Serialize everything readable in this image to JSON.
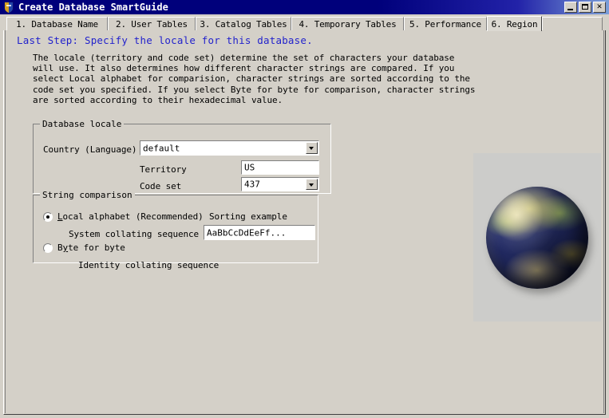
{
  "window": {
    "title": "Create Database SmartGuide",
    "icon": "app-icon",
    "buttons": {
      "minimize": "minimize",
      "maximize": "maximize",
      "close": "close"
    }
  },
  "tabs": [
    {
      "label": "1. Database Name",
      "active": false
    },
    {
      "label": "2. User Tables",
      "active": false
    },
    {
      "label": "3. Catalog Tables",
      "active": false
    },
    {
      "label": "4. Temporary Tables",
      "active": false
    },
    {
      "label": "5. Performance",
      "active": false
    },
    {
      "label": "6. Region",
      "active": true
    }
  ],
  "page": {
    "heading": "Last Step: Specify the locale for this database.",
    "description": "The locale (territory and code set) determine the set of characters your database will use. It also determines how different character strings are compared. If you select Local alphabet for comparision, character strings are sorted according to the code set you specified. If you select Byte for byte for comparison, character strings are sorted according to their hexadecimal value."
  },
  "database_locale": {
    "title": "Database locale",
    "country_label": "Country (Language)",
    "country_value": "default",
    "territory_label": "Territory",
    "territory_value": "US",
    "codeset_label": "Code set",
    "codeset_value": "437"
  },
  "string_comparison": {
    "title": "String comparison",
    "option_local": {
      "label": "Local alphabet (Recommended)",
      "accel": "L",
      "sub_label": "System collating sequence",
      "selected": true
    },
    "option_byte": {
      "label": "Byte for byte",
      "accel": "y",
      "sub_label": "Identity collating sequence",
      "selected": false
    },
    "sorting_example_label": "Sorting example",
    "sorting_example_value": "AaBbCcDdEeFf..."
  },
  "illustration": {
    "name": "globe-earth-image",
    "alt": "Globe showing the Earth"
  },
  "colors": {
    "titlebar": "#00007b",
    "heading": "#2222cc",
    "face": "#d4d0c8",
    "panel": "#ccccca"
  }
}
